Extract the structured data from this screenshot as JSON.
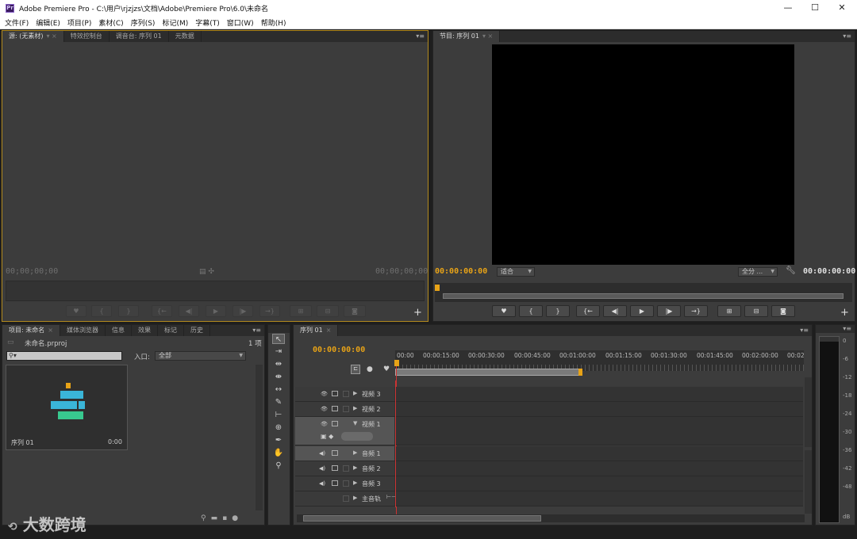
{
  "window": {
    "title": "Adobe Premiere Pro - C:\\用户\\rjzjzs\\文档\\Adobe\\Premiere Pro\\6.0\\未命名",
    "app_icon": "Pr",
    "minimize": "—",
    "maximize": "☐",
    "close": "✕"
  },
  "menu": [
    "文件(F)",
    "编辑(E)",
    "项目(P)",
    "素材(C)",
    "序列(S)",
    "标记(M)",
    "字幕(T)",
    "窗口(W)",
    "帮助(H)"
  ],
  "source_panel": {
    "tabs": [
      "源: (无素材)",
      "特效控制台",
      "调音台: 序列 01",
      "元数据"
    ],
    "tc_left": "00;00;00;00",
    "tc_right": "00;00;00;00"
  },
  "program_panel": {
    "tab": "节目: 序列 01",
    "tc_current": "00:00:00:00",
    "fit_label": "适合",
    "quality_label": "全分 ...",
    "tc_duration": "00:00:00:00"
  },
  "project_panel": {
    "tabs": [
      "项目: 未命名",
      "媒体浏览器",
      "信息",
      "效果",
      "标记",
      "历史"
    ],
    "project_file": "未命名.prproj",
    "item_count": "1 项",
    "search_placeholder": "",
    "in_label": "入口:",
    "in_value": "全部",
    "thumb_name": "序列 01",
    "thumb_duration": "0:00"
  },
  "timeline": {
    "tab": "序列 01",
    "tc": "00:00:00:00",
    "ruler": [
      "00:00",
      "00:00:15:00",
      "00:00:30:00",
      "00:00:45:00",
      "00:01:00:00",
      "00:01:15:00",
      "00:01:30:00",
      "00:01:45:00",
      "00:02:00:00",
      "00:02"
    ],
    "video_tracks": [
      "视频 3",
      "视频 2",
      "视频 1"
    ],
    "audio_tracks": [
      "音频 1",
      "音频 2",
      "音频 3"
    ],
    "master_track": "主音轨"
  },
  "meter": {
    "labels": [
      "0",
      "-6",
      "-12",
      "-18",
      "-24",
      "-30",
      "-36",
      "-42",
      "-48",
      "dB"
    ]
  },
  "watermark": "大数跨境"
}
